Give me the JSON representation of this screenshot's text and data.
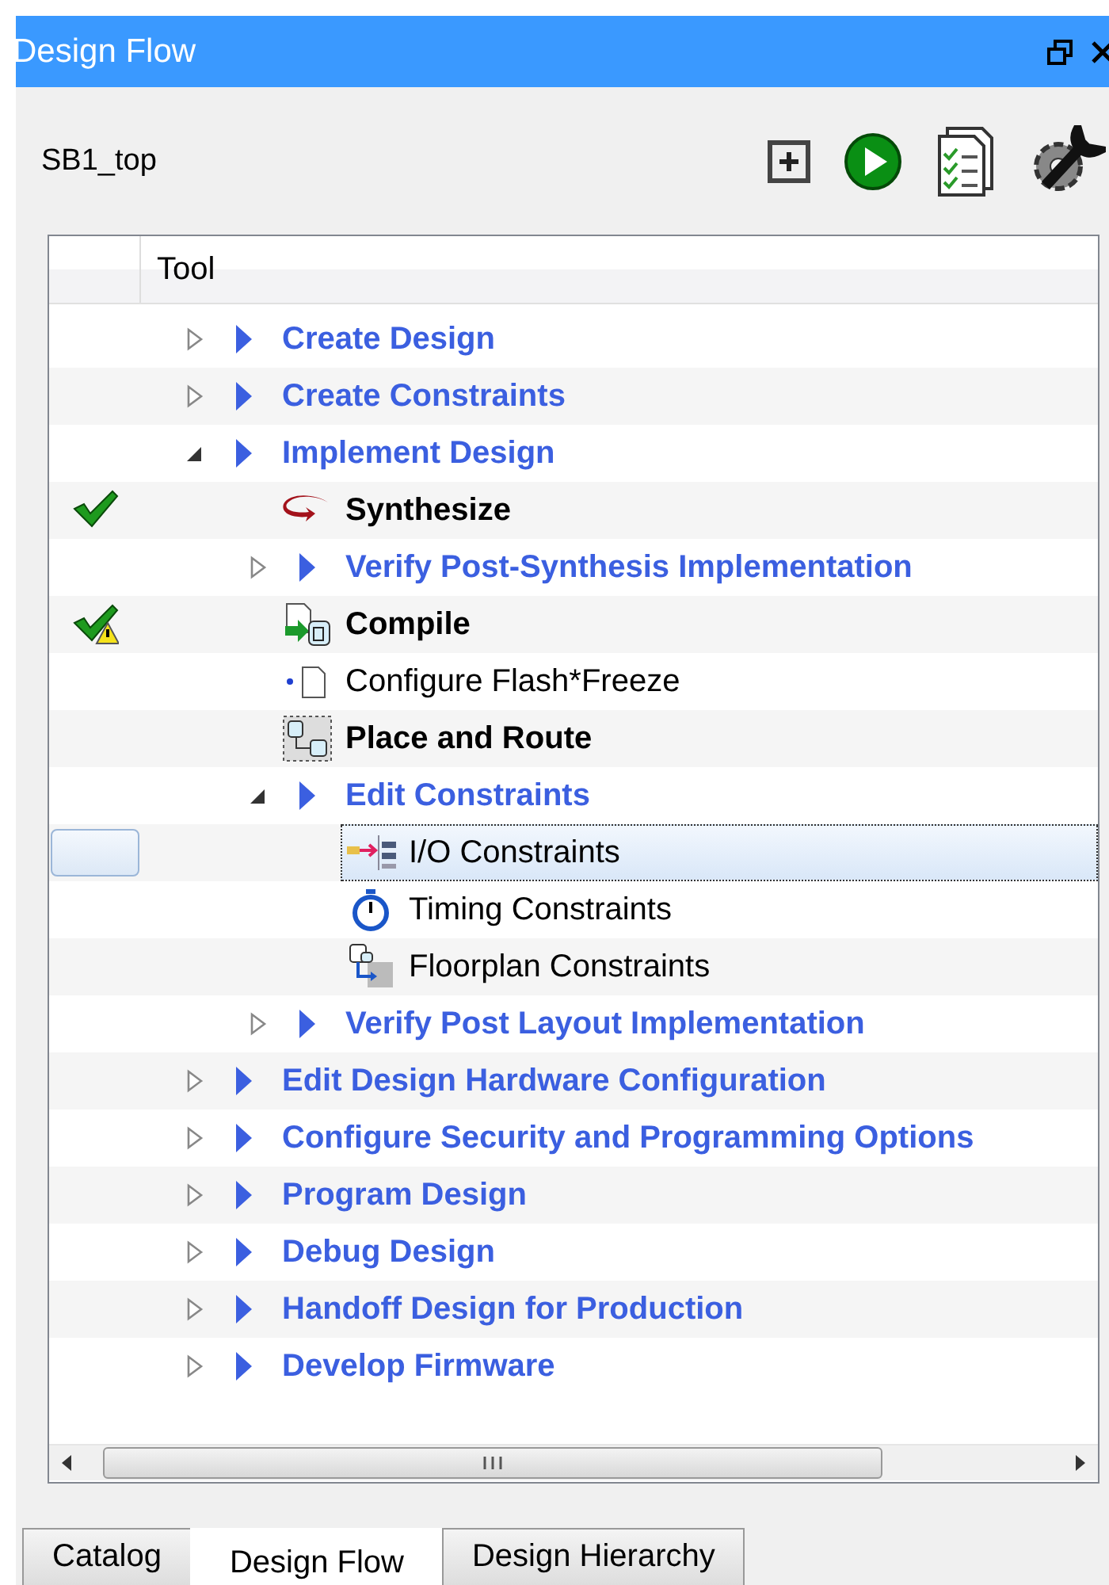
{
  "window": {
    "title": "Design Flow"
  },
  "project": "SB1_top",
  "tree": {
    "column": "Tool",
    "items": [
      {
        "label": "Create Design",
        "kind": "group",
        "expanded": false,
        "selected": false
      },
      {
        "label": "Create Constraints",
        "kind": "group",
        "expanded": false,
        "selected": false
      },
      {
        "label": "Implement Design",
        "kind": "group",
        "expanded": true,
        "selected": false,
        "children": [
          {
            "label": "Synthesize",
            "kind": "tool",
            "completed": true,
            "warning": false,
            "selected": false
          },
          {
            "label": "Verify Post-Synthesis Implementation",
            "kind": "group",
            "expanded": false,
            "selected": false
          },
          {
            "label": "Compile",
            "kind": "tool",
            "completed": true,
            "warning": true,
            "selected": false
          },
          {
            "label": "Configure Flash*Freeze",
            "kind": "plain",
            "selected": false
          },
          {
            "label": "Place and Route",
            "kind": "tool",
            "completed": false,
            "warning": false,
            "selected": false
          },
          {
            "label": "Edit Constraints",
            "kind": "group",
            "expanded": true,
            "selected": false,
            "children": [
              {
                "label": "I/O Constraints",
                "kind": "plain",
                "selected": true
              },
              {
                "label": "Timing Constraints",
                "kind": "plain",
                "selected": false
              },
              {
                "label": "Floorplan Constraints",
                "kind": "plain",
                "selected": false
              }
            ]
          },
          {
            "label": "Verify Post Layout Implementation",
            "kind": "group",
            "expanded": false,
            "selected": false
          }
        ]
      },
      {
        "label": "Edit Design Hardware Configuration",
        "kind": "group",
        "expanded": false,
        "selected": false
      },
      {
        "label": "Configure Security and Programming Options",
        "kind": "group",
        "expanded": false,
        "selected": false
      },
      {
        "label": "Program Design",
        "kind": "group",
        "expanded": false,
        "selected": false
      },
      {
        "label": "Debug Design",
        "kind": "group",
        "expanded": false,
        "selected": false
      },
      {
        "label": "Handoff Design for Production",
        "kind": "group",
        "expanded": false,
        "selected": false
      },
      {
        "label": "Develop Firmware",
        "kind": "group",
        "expanded": false,
        "selected": false
      }
    ]
  },
  "tabs": [
    {
      "label": "Catalog",
      "selected": false
    },
    {
      "label": "Design Flow",
      "selected": true
    },
    {
      "label": "Design Hierarchy",
      "selected": false
    }
  ]
}
